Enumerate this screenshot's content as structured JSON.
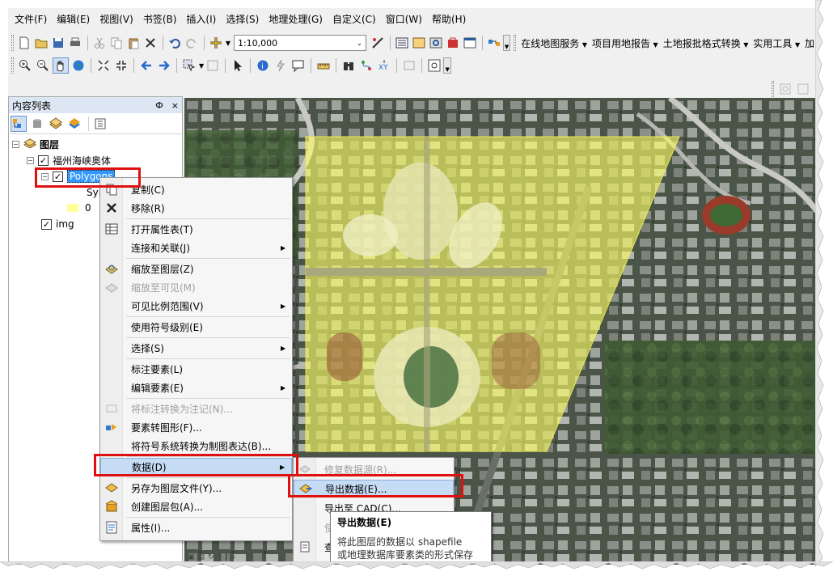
{
  "menubar": {
    "items": [
      "文件(F)",
      "编辑(E)",
      "视图(V)",
      "书签(B)",
      "插入(I)",
      "选择(S)",
      "地理处理(G)",
      "自定义(C)",
      "窗口(W)",
      "帮助(H)"
    ]
  },
  "toolbar": {
    "scale_value": "1:10,000",
    "dropdowns": [
      "在线地图服务",
      "项目用地报告",
      "土地报批格式转换",
      "实用工具",
      "加"
    ]
  },
  "toc": {
    "title": "内容列表",
    "pin": "Ф",
    "close": "×",
    "root_label": "图层",
    "group_label": "福州海峡奥体",
    "layer_label": "Polygons",
    "symbol_label": "Sym",
    "class_value": "0",
    "img_label": "img"
  },
  "context_menu": {
    "items": [
      {
        "label": "复制(C)",
        "icon": "copy-icon",
        "disabled": false,
        "submenu": false
      },
      {
        "label": "移除(R)",
        "icon": "remove-x-icon",
        "disabled": false,
        "submenu": false
      },
      {
        "label": "打开属性表(T)",
        "icon": "table-icon",
        "disabled": false,
        "submenu": false
      },
      {
        "label": "连接和关联(J)",
        "icon": "",
        "disabled": false,
        "submenu": true
      },
      {
        "label": "缩放至图层(Z)",
        "icon": "zoom-layer-icon",
        "disabled": false,
        "submenu": false
      },
      {
        "label": "缩放至可见(M)",
        "icon": "zoom-visible-icon",
        "disabled": true,
        "submenu": false
      },
      {
        "label": "可见比例范围(V)",
        "icon": "",
        "disabled": false,
        "submenu": true
      },
      {
        "label": "使用符号级别(E)",
        "icon": "",
        "disabled": false,
        "submenu": false
      },
      {
        "label": "选择(S)",
        "icon": "",
        "disabled": false,
        "submenu": true
      },
      {
        "label": "标注要素(L)",
        "icon": "",
        "disabled": false,
        "submenu": false
      },
      {
        "label": "编辑要素(E)",
        "icon": "",
        "disabled": false,
        "submenu": true
      },
      {
        "label": "将标注转换为注记(N)...",
        "icon": "convert-labels-icon",
        "disabled": true,
        "submenu": false
      },
      {
        "label": "要素转图形(F)...",
        "icon": "features-to-graphics-icon",
        "disabled": false,
        "submenu": false
      },
      {
        "label": "将符号系统转换为制图表达(B)...",
        "icon": "",
        "disabled": false,
        "submenu": false
      },
      {
        "label": "数据(D)",
        "icon": "",
        "disabled": false,
        "submenu": true
      },
      {
        "label": "另存为图层文件(Y)...",
        "icon": "save-layer-icon",
        "disabled": false,
        "submenu": false
      },
      {
        "label": "创建图层包(A)...",
        "icon": "layer-package-icon",
        "disabled": false,
        "submenu": false
      },
      {
        "label": "属性(I)...",
        "icon": "properties-icon",
        "disabled": false,
        "submenu": false
      }
    ]
  },
  "data_submenu": {
    "items": [
      {
        "label": "修复数据源(R)...",
        "disabled": true
      },
      {
        "label": "导出数据(E)...",
        "disabled": false
      },
      {
        "label": "导出至 CAD(C)...",
        "disabled": false
      },
      {
        "label": "使",
        "disabled": true
      },
      {
        "label": "查",
        "disabled": false
      }
    ]
  },
  "tooltip": {
    "title": "导出数据(E)",
    "line1": "将此图层的数据以 shapefile",
    "line2": "或地理数据库要素类的形式保存"
  },
  "colors": {
    "polygon_fill": "#ffff66",
    "highlight_red": "#e01010",
    "menu_highlight": "#c6dcf5",
    "selection_blue": "#3399ff"
  }
}
